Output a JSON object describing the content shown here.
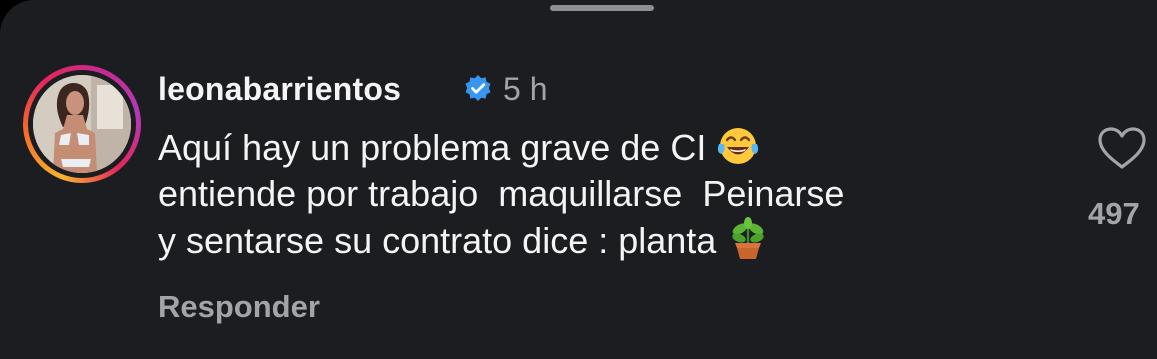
{
  "comment": {
    "username": "leonabarrientos",
    "timestamp": "5 h",
    "text_lines": [
      "Aquí hay un problema grave de CI",
      "entiende por trabajo  maquillarse  Peinarse",
      "y sentarse su contrato dice : planta"
    ],
    "reply_label": "Responder",
    "like_count": "497"
  },
  "icons": {
    "verified": "verified-badge-icon",
    "heart": "heart-icon",
    "emoji_1": "tears-of-joy-emoji",
    "emoji_2": "potted-plant-emoji"
  },
  "colors": {
    "background": "#1b1d21",
    "text": "#f4f4f5",
    "muted_text": "#a2a4aa",
    "verified_blue": "#3797f0"
  }
}
